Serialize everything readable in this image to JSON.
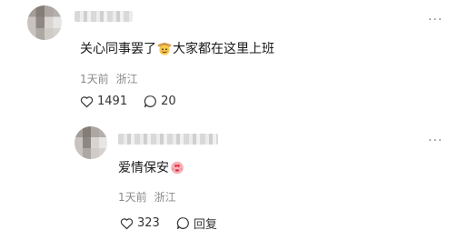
{
  "comments": [
    {
      "username": "",
      "text_before": "关心同事罢了",
      "emoji": "cowboy-face-emoji",
      "text_after": "大家都在这里上班",
      "time": "1天前",
      "location": "浙江",
      "likes": "1491",
      "replies": "20",
      "more": "···"
    },
    {
      "username": "",
      "text_before": "爱情保安",
      "emoji": "heart-eyes-emoji",
      "text_after": "",
      "time": "1天前",
      "location": "浙江",
      "likes": "323",
      "reply_label": "回复",
      "more": "···"
    }
  ],
  "colors": {
    "text": "#1a1a1a",
    "meta": "#8a8a8a",
    "icon": "#333333"
  }
}
